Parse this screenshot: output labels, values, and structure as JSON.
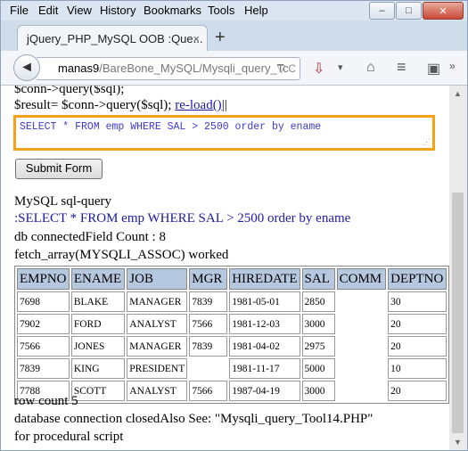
{
  "menu": [
    "File",
    "Edit",
    "View",
    "History",
    "Bookmarks",
    "Tools",
    "Help"
  ],
  "window_controls": {
    "minimize": "–",
    "maximize": "□",
    "close": "✕"
  },
  "tab": {
    "title": "jQuery_PHP_MySQL OOB :Que...",
    "close": "×",
    "newtab": "+"
  },
  "nav": {
    "back": "◄",
    "host": "manas9",
    "path": "/BareBone_MySQL/Mysqli_query_Tc",
    "url_icons": "▽ C"
  },
  "content": {
    "line1": "$conn->query($sql);",
    "line2_prefix": "$result= $conn->query($sql);",
    "reload_link": "re-load()",
    "reload_suffix": "||",
    "sql_input": "SELECT * FROM emp WHERE SAL > 2500 order by ename",
    "submit_label": "Submit Form",
    "heading": "MySQL sql-query",
    "query_text": ":SELECT * FROM emp WHERE SAL > 2500 order by ename",
    "field_count": "db connectedField Count : 8",
    "fetch_text": "fetch_array(MYSQLI_ASSOC) worked",
    "row_count": "row count 5",
    "closed_text": "database connection closedAlso See: \"Mysqli_query_Tool14.PHP\"",
    "procedural": "for procedural script"
  },
  "table": {
    "headers": [
      "EMPNO",
      "ENAME",
      "JOB",
      "MGR",
      "HIREDATE",
      "SAL",
      "COMM",
      "DEPTNO"
    ],
    "rows": [
      [
        "7698",
        "BLAKE",
        "MANAGER",
        "7839",
        "1981-05-01",
        "2850",
        "",
        "30"
      ],
      [
        "7902",
        "FORD",
        "ANALYST",
        "7566",
        "1981-12-03",
        "3000",
        "",
        "20"
      ],
      [
        "7566",
        "JONES",
        "MANAGER",
        "7839",
        "1981-04-02",
        "2975",
        "",
        "20"
      ],
      [
        "7839",
        "KING",
        "PRESIDENT",
        "",
        "1981-11-17",
        "5000",
        "",
        "10"
      ],
      [
        "7788",
        "SCOTT",
        "ANALYST",
        "7566",
        "1987-04-19",
        "3000",
        "",
        "20"
      ]
    ]
  }
}
